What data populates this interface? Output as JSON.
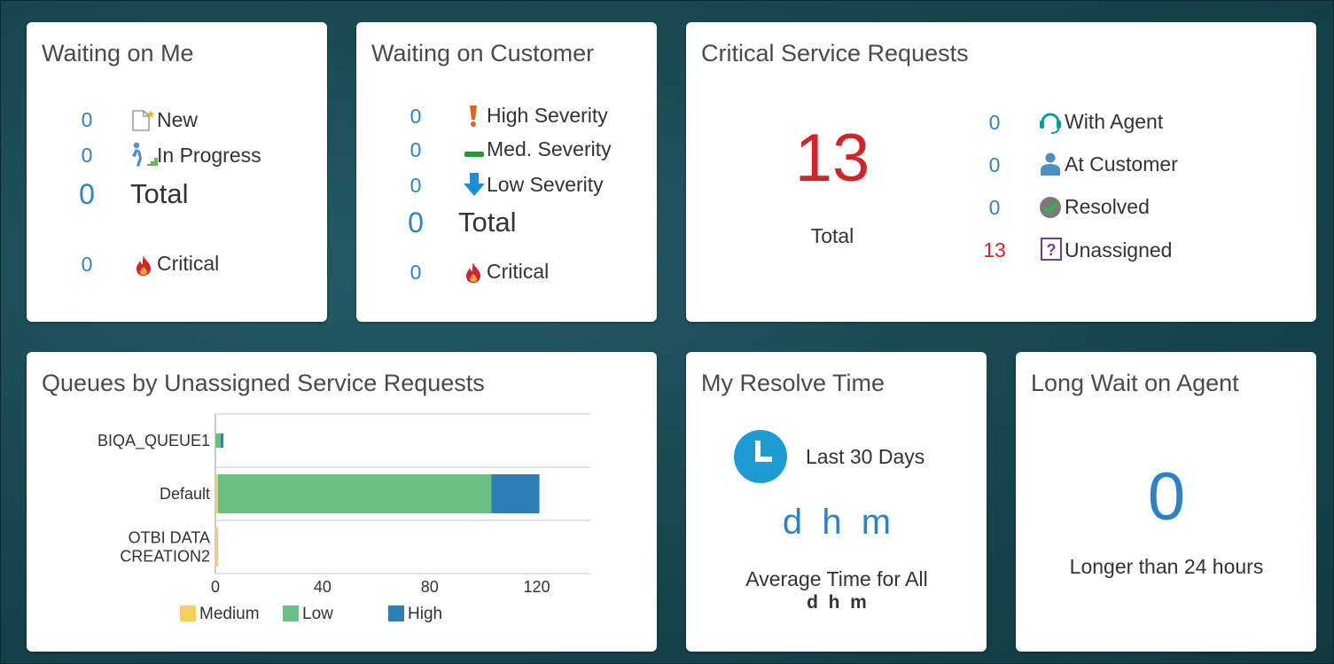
{
  "waiting_on_me": {
    "title": "Waiting on Me",
    "new_count": "0",
    "new_label": "New",
    "in_progress_count": "0",
    "in_progress_label": "In Progress",
    "total_count": "0",
    "total_label": "Total",
    "critical_count": "0",
    "critical_label": "Critical"
  },
  "waiting_on_customer": {
    "title": "Waiting on Customer",
    "high_count": "0",
    "high_label": "High Severity",
    "med_count": "0",
    "med_label": "Med. Severity",
    "low_count": "0",
    "low_label": "Low Severity",
    "total_count": "0",
    "total_label": "Total",
    "critical_count": "0",
    "critical_label": "Critical"
  },
  "critical_requests": {
    "title": "Critical Service Requests",
    "total_count": "13",
    "total_label": "Total",
    "with_agent_count": "0",
    "with_agent_label": "With Agent",
    "at_customer_count": "0",
    "at_customer_label": "At Customer",
    "resolved_count": "0",
    "resolved_label": "Resolved",
    "unassigned_count": "13",
    "unassigned_label": "Unassigned"
  },
  "queues": {
    "title": "Queues by Unassigned Service Requests"
  },
  "resolve_time": {
    "title": "My Resolve Time",
    "period_label": "Last 30 Days",
    "value": "d  h  m",
    "avg_label": "Average Time for All",
    "avg_value": "d  h  m"
  },
  "long_wait": {
    "title": "Long Wait on Agent",
    "count": "0",
    "label": "Longer than 24 hours"
  },
  "colors": {
    "accent_blue": "#2e82c3",
    "critical_red": "#d0252b",
    "medium": "#f8cf5f",
    "low": "#6abf84",
    "high": "#2d7fb8"
  },
  "chart_data": {
    "type": "bar",
    "orientation": "horizontal",
    "stacked": true,
    "categories": [
      "BIQA_QUEUE1",
      "Default",
      "OTBI DATA\nCREATION2"
    ],
    "series": [
      {
        "name": "Medium",
        "values": [
          0,
          1,
          1
        ]
      },
      {
        "name": "Low",
        "values": [
          2,
          102,
          0
        ]
      },
      {
        "name": "High",
        "values": [
          1,
          18,
          0
        ]
      }
    ],
    "xticks": [
      "0",
      "40",
      "80",
      "120"
    ],
    "xlim": [
      0,
      140
    ],
    "legend": "bottom"
  }
}
